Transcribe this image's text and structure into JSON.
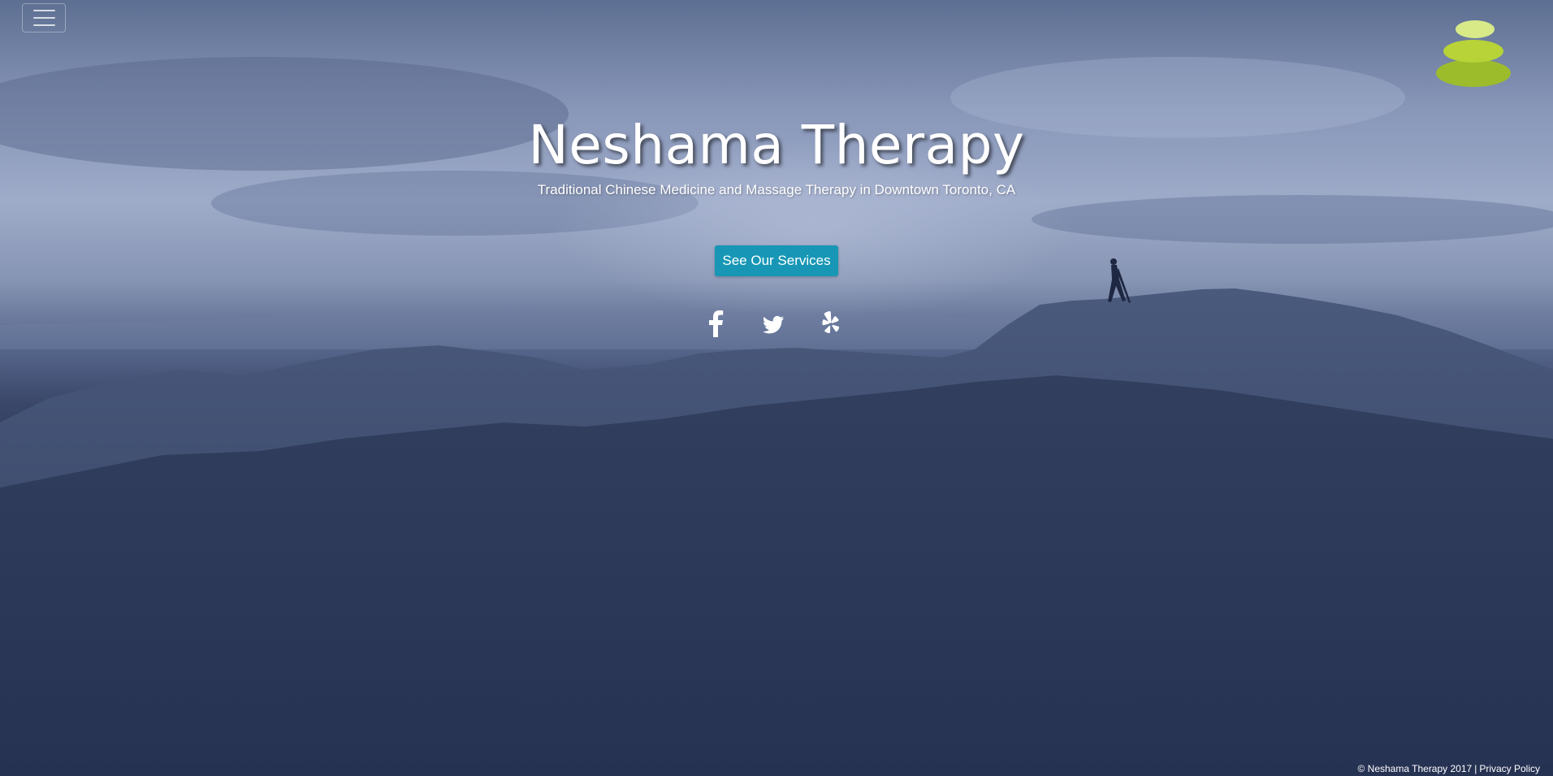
{
  "hero": {
    "title": "Neshama Therapy",
    "subtitle": "Traditional Chinese Medicine and Massage Therapy in Downtown Toronto, CA",
    "cta_label": "See Our Services"
  },
  "header": {
    "menu_icon": "hamburger-icon",
    "logo_icon": "stacked-stones-logo"
  },
  "social": [
    {
      "name": "facebook",
      "icon": "facebook-icon"
    },
    {
      "name": "twitter",
      "icon": "twitter-icon"
    },
    {
      "name": "yelp",
      "icon": "yelp-icon"
    }
  ],
  "footer": {
    "copyright": "© Neshama Therapy 2017",
    "separator": "|",
    "privacy_label": "Privacy Policy"
  },
  "colors": {
    "cta_background": "#1797b5",
    "logo_green_light": "#d8ea88",
    "logo_green_mid": "#b7d337",
    "logo_green_dark": "#9cbc2c"
  }
}
